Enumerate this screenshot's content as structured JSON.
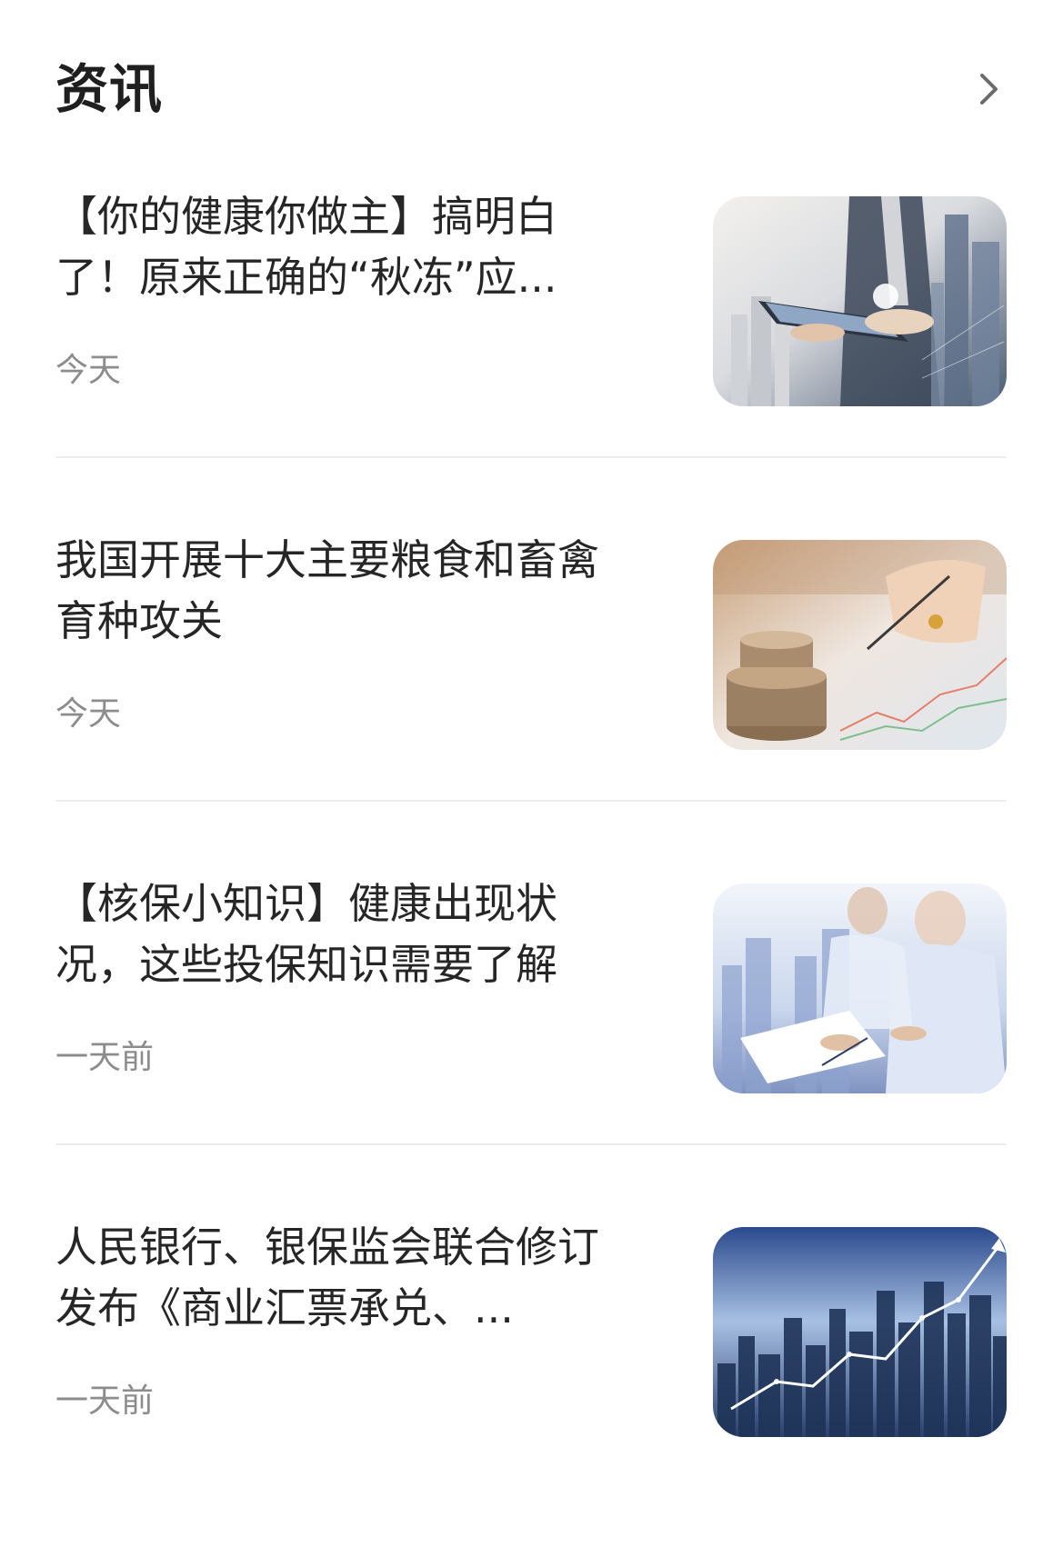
{
  "header": {
    "title": "资讯",
    "more_icon": "chevron-right-icon"
  },
  "news": [
    {
      "title": "【你的健康你做主】搞明白了！原来正确的“秋冻”应...",
      "time": "今天",
      "thumbnail": "businessman-tablet-city-image"
    },
    {
      "title": "我国开展十大主要粮食和畜禽育种攻关",
      "time": "今天",
      "thumbnail": "coins-writing-chart-image"
    },
    {
      "title": "【核保小知识】健康出现状况，这些投保知识需要了解",
      "time": "一天前",
      "thumbnail": "business-meeting-city-image"
    },
    {
      "title": "人民银行、银保监会联合修订发布《商业汇票承兑、...",
      "time": "一天前",
      "thumbnail": "city-growth-chart-image"
    }
  ]
}
